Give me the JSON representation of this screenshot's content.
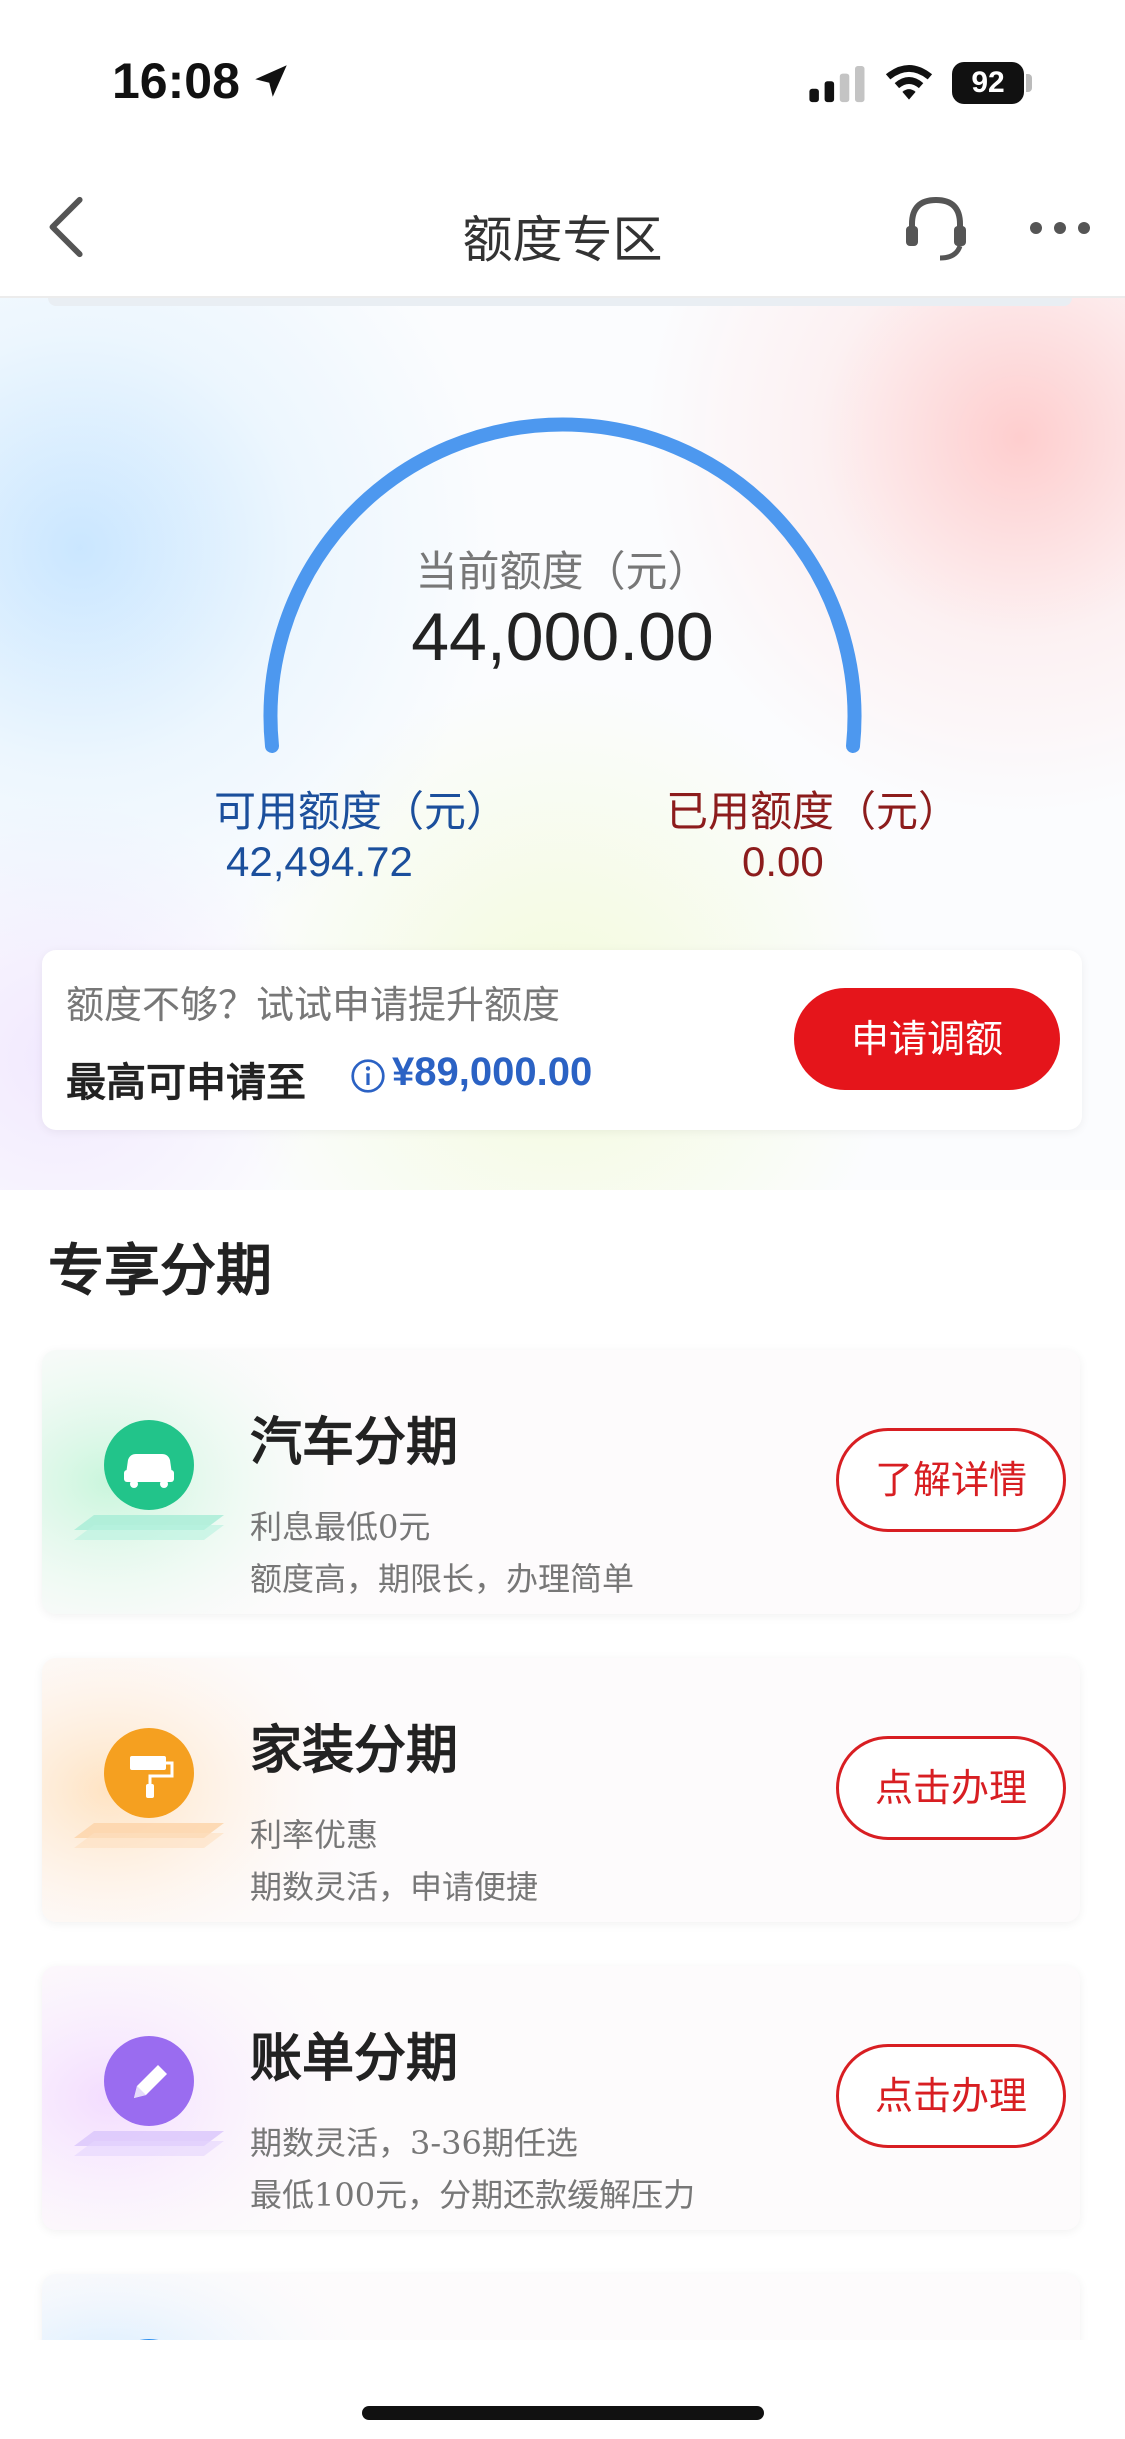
{
  "status_bar": {
    "time": "16:08",
    "battery": "92",
    "icons": [
      "location-arrow-icon",
      "signal-icon",
      "wifi-icon",
      "battery-icon"
    ]
  },
  "nav": {
    "title": "额度专区",
    "icons": [
      "back-icon",
      "customer-service-icon",
      "more-icon"
    ]
  },
  "credit": {
    "current_label": "当前额度（元）",
    "current_value": "44,000.00",
    "available_label": "可用额度（元）",
    "available_value": "42,494.72",
    "used_label": "已用额度（元）",
    "used_value": "0.00",
    "gauge_color": "#4d98ef"
  },
  "raise": {
    "hint": "额度不够？试试申请提升额度",
    "prefix": "最高可申请至",
    "amount": "¥89,000.00",
    "button": "申请调额"
  },
  "section": {
    "title": "专享分期"
  },
  "products": [
    {
      "title": "汽车分期",
      "line1": "利息最低0元",
      "line2": "额度高，期限长，办理简单",
      "button": "了解详情",
      "icon": "car-icon",
      "color": "#22c48a"
    },
    {
      "title": "家装分期",
      "line1": "利率优惠",
      "line2": "期数灵活，申请便捷",
      "button": "点击办理",
      "icon": "paint-roller-icon",
      "color": "#f5a020"
    },
    {
      "title": "账单分期",
      "line1": "期数灵活，3-36期任选",
      "line2": "最低100元，分期还款缓解压力",
      "button": "点击办理",
      "icon": "pencil-icon",
      "color": "#9a6cf0"
    }
  ],
  "colors": {
    "primary_red": "#e5151b",
    "blue_text": "#1b4f9c",
    "red_text": "#8c1c1c",
    "amount_blue": "#2b62c4"
  }
}
